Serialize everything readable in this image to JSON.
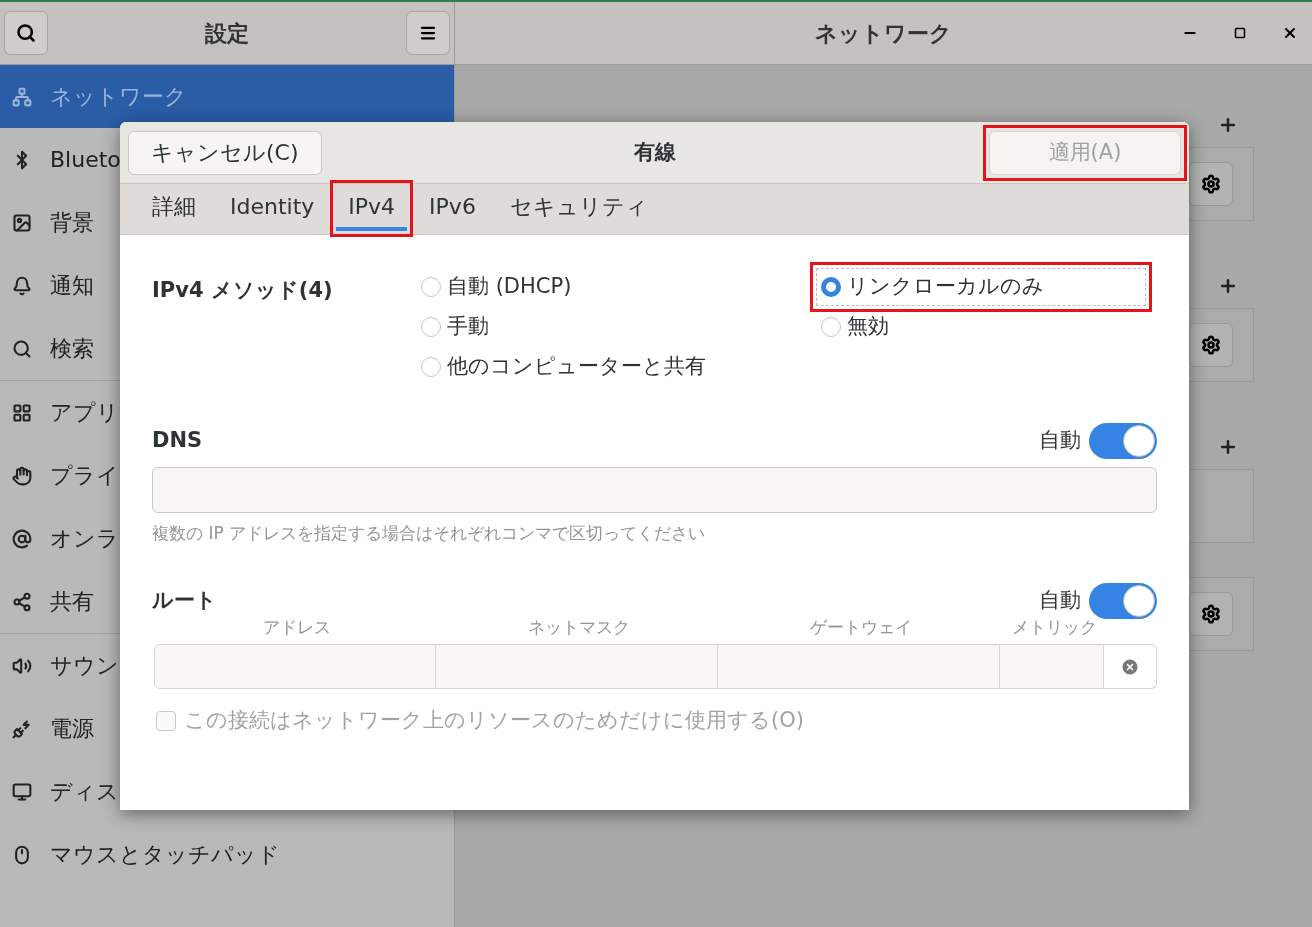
{
  "header": {
    "sidebar_title": "設定",
    "window_title": "ネットワーク"
  },
  "sidebar": {
    "items": [
      {
        "label": "ネットワーク",
        "selected": true
      },
      {
        "label": "Blueto",
        "selected": false
      },
      {
        "label": "背景",
        "selected": false
      },
      {
        "label": "通知",
        "selected": false
      },
      {
        "label": "検索",
        "selected": false
      },
      {
        "label": "アプリ",
        "selected": false
      },
      {
        "label": "プライ",
        "selected": false
      },
      {
        "label": "オンラ",
        "selected": false
      },
      {
        "label": "共有",
        "selected": false
      },
      {
        "label": "サウン",
        "selected": false
      },
      {
        "label": "電源",
        "selected": false
      },
      {
        "label": "ディス",
        "selected": false
      },
      {
        "label": "マウスとタッチパッド",
        "selected": false
      }
    ]
  },
  "dialog": {
    "title": "有線",
    "cancel": "キャンセル(C)",
    "apply": {
      "label": "適用(A)",
      "disabled": true,
      "highlighted": true
    },
    "tabs": [
      {
        "label": "詳細",
        "selected": false,
        "highlighted": false
      },
      {
        "label": "Identity",
        "selected": false,
        "highlighted": false
      },
      {
        "label": "IPv4",
        "selected": true,
        "highlighted": true
      },
      {
        "label": "IPv6",
        "selected": false,
        "highlighted": false
      },
      {
        "label": "セキュリティ",
        "selected": false,
        "highlighted": false
      }
    ],
    "method": {
      "label": "IPv4 メソッド(4)",
      "columns": [
        [
          {
            "label": "自動 (DHCP)",
            "selected": false,
            "highlighted": false
          },
          {
            "label": "手動",
            "selected": false,
            "highlighted": false
          },
          {
            "label": "他のコンピューターと共有",
            "selected": false,
            "highlighted": false
          }
        ],
        [
          {
            "label": "リンクローカルのみ",
            "selected": true,
            "highlighted": true
          },
          {
            "label": "無効",
            "selected": false,
            "highlighted": false
          }
        ]
      ]
    },
    "dns": {
      "label": "DNS",
      "auto_label": "自動",
      "auto_on": true,
      "hint": "複数の IP アドレスを指定する場合はそれぞれコンマで区切ってください"
    },
    "routes": {
      "label": "ルート",
      "auto_label": "自動",
      "auto_on": true,
      "columns": [
        "アドレス",
        "ネットマスク",
        "ゲートウェイ",
        "メトリック"
      ]
    },
    "only_local": {
      "label": "この接続はネットワーク上のリソースのためだけに使用する(O)",
      "checked": false,
      "disabled": true
    }
  }
}
